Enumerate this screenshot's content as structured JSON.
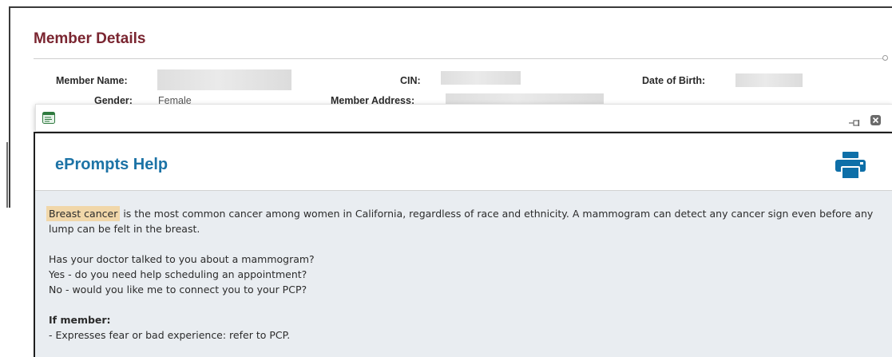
{
  "page": {
    "title": "Member Details",
    "fields": {
      "member_name_label": "Member Name:",
      "cin_label": "CIN:",
      "dob_label": "Date of Birth:",
      "gender_label": "Gender:",
      "gender_value": "Female",
      "address_label": "Member Address:"
    }
  },
  "help": {
    "title": "ePrompts Help",
    "highlight": "Breast cancer",
    "intro_rest": " is the most common cancer among women in California, regardless of race and ethnicity. A mammogram can detect any cancer sign even before any lump can be felt in the breast.",
    "question": "Has your doctor talked to you about a mammogram?",
    "yes_line": "Yes - do you need help scheduling an appointment?",
    "no_line": "No - would you like me to connect you to your PCP?",
    "if_member": "If member:",
    "fear_line": "- Expresses fear or bad experience: refer to PCP."
  },
  "icons": {
    "window": "window-icon",
    "pin": "pin-icon",
    "close": "close-icon",
    "print": "print-icon"
  },
  "colors": {
    "title_maroon": "#7a2530",
    "help_title_blue": "#1c73a6",
    "print_blue": "#0e6fa8",
    "highlight": "#f1d7a9",
    "panel_bg": "#e9edf1"
  }
}
